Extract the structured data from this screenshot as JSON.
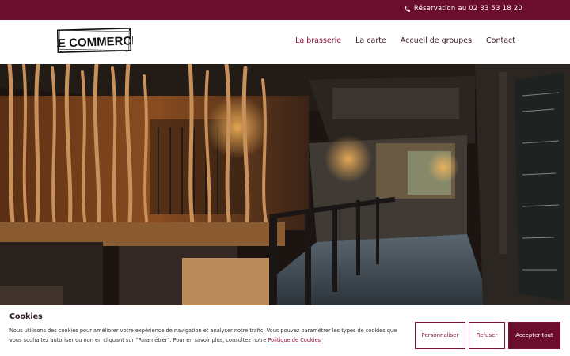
{
  "topbar": {
    "reservation_label": "Réservation au 02 33 53 18 20"
  },
  "logo": {
    "text": "LE COMMERCE"
  },
  "nav": [
    {
      "label": "La brasserie"
    },
    {
      "label": "La carte"
    },
    {
      "label": "Accueil de groupes"
    },
    {
      "label": "Contact"
    }
  ],
  "cookie": {
    "title": "Cookies",
    "text_before": "Nous utilisons des cookies pour améliorer votre expérience de navigation et analyser notre trafic. Vous pouvez paramétrer les types de cookies que vous souhaitez autoriser ou non en cliquant sur \"Paramétrer\". Pour en savoir plus, consultez notre ",
    "policy_link": "Politique de Cookies",
    "buttons": {
      "customize": "Personnaliser",
      "refuse": "Refuser",
      "accept": "Accepter tout"
    }
  },
  "colors": {
    "brand": "#6b0d2c",
    "nav_active": "#8a1438"
  }
}
